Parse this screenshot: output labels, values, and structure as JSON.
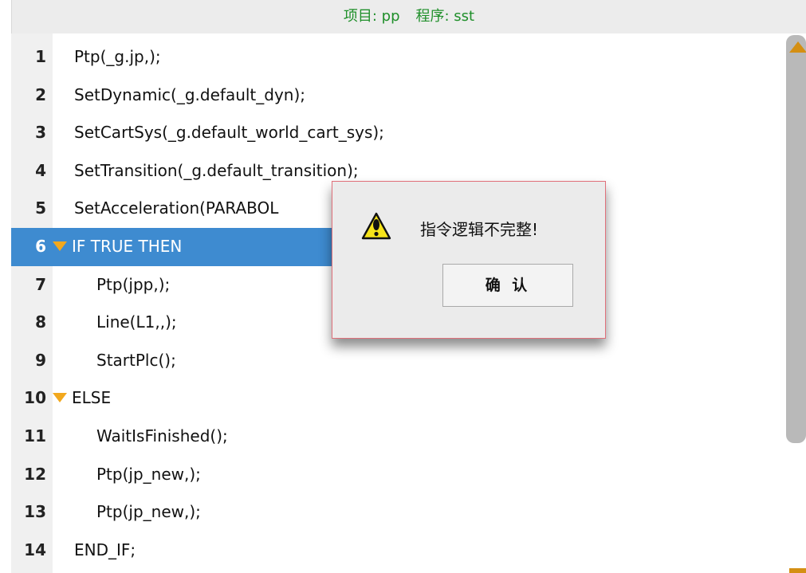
{
  "header": {
    "project": "项目: pp",
    "program": "程序: sst",
    "color": "#1f8f2a"
  },
  "editor": {
    "selected_line": 6,
    "selected_color": "#3e8bd0",
    "fold_marker_color": "#f2a81d",
    "lines": [
      {
        "num": "1",
        "code": "Ptp(_g.jp,);"
      },
      {
        "num": "2",
        "code": "SetDynamic(_g.default_dyn);"
      },
      {
        "num": "3",
        "code": "SetCartSys(_g.default_world_cart_sys);"
      },
      {
        "num": "4",
        "code": "SetTransition(_g.default_transition);"
      },
      {
        "num": "5",
        "code": "SetAcceleration(PARABOL"
      },
      {
        "num": "6",
        "code": "IF TRUE THEN"
      },
      {
        "num": "7",
        "code": "Ptp(jpp,);"
      },
      {
        "num": "8",
        "code": "Line(L1,,);"
      },
      {
        "num": "9",
        "code": "StartPlc();"
      },
      {
        "num": "10",
        "code": "ELSE"
      },
      {
        "num": "11",
        "code": "WaitIsFinished();"
      },
      {
        "num": "12",
        "code": "Ptp(jp_new,);"
      },
      {
        "num": "13",
        "code": "Ptp(jp_new,);"
      },
      {
        "num": "14",
        "code": "END_IF;"
      }
    ]
  },
  "scrollbar": {
    "arrow_color": "#d48f13"
  },
  "dialog": {
    "icon": "warning-icon",
    "message": "指令逻辑不完整!",
    "ok_label": "确 认"
  }
}
